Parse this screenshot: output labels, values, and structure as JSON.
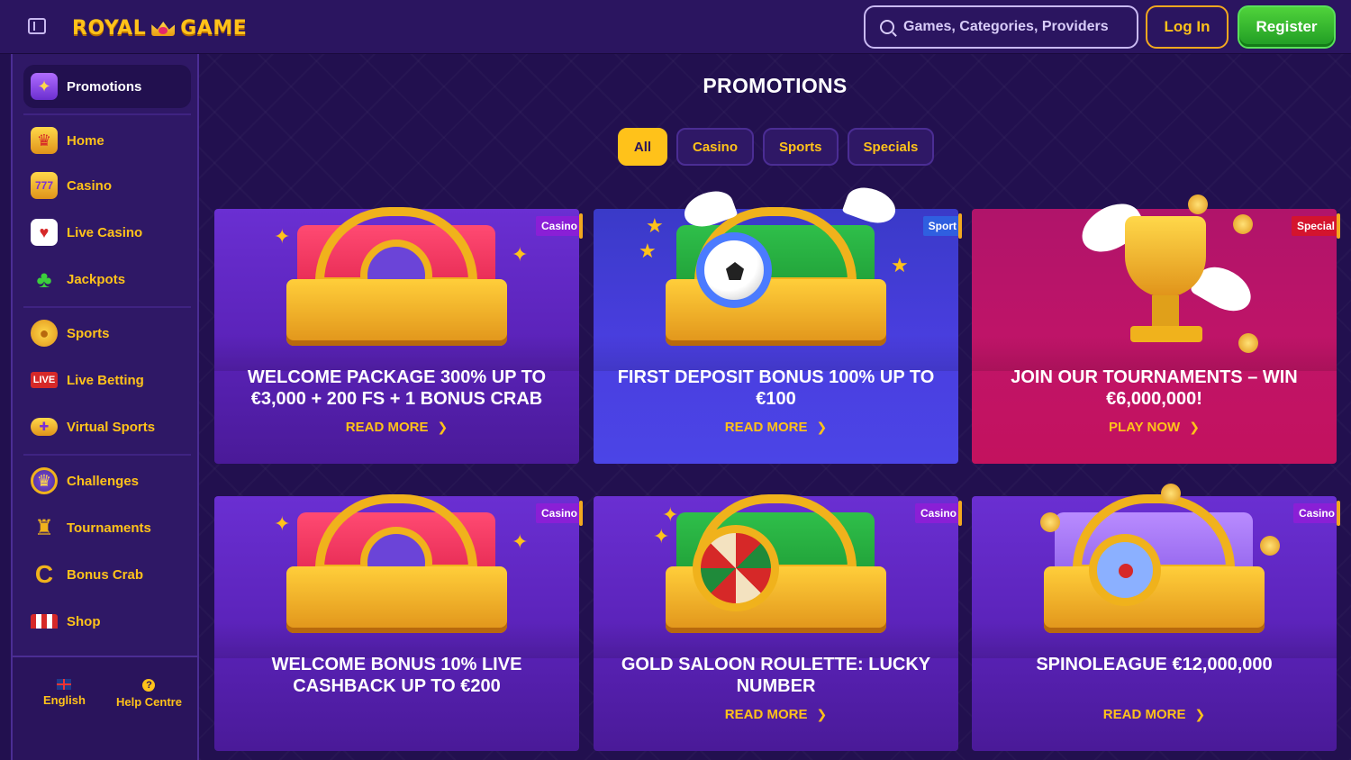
{
  "header": {
    "brand_part1": "ROYAL",
    "brand_part2": "GAME",
    "search_placeholder": "Games, Categories, Providers",
    "login_label": "Log In",
    "register_label": "Register"
  },
  "sidebar": {
    "items": [
      {
        "label": "Promotions",
        "icon": "gift-icon"
      },
      {
        "label": "Home",
        "icon": "crown-home-icon"
      },
      {
        "label": "Casino",
        "icon": "slot-machine-icon"
      },
      {
        "label": "Live Casino",
        "icon": "cards-icon"
      },
      {
        "label": "Jackpots",
        "icon": "clover-icon"
      },
      {
        "label": "Sports",
        "icon": "ball-icon"
      },
      {
        "label": "Live Betting",
        "icon": "live-badge-icon",
        "badge": "LIVE"
      },
      {
        "label": "Virtual Sports",
        "icon": "gamepad-icon"
      },
      {
        "label": "Challenges",
        "icon": "medal-icon"
      },
      {
        "label": "Tournaments",
        "icon": "trophy-icon"
      },
      {
        "label": "Bonus Crab",
        "icon": "crab-claw-icon"
      },
      {
        "label": "Shop",
        "icon": "shop-icon"
      }
    ],
    "footer": {
      "language_label": "English",
      "help_label": "Help Centre",
      "help_glyph": "?"
    }
  },
  "main": {
    "title": "PROMOTIONS",
    "filters": [
      "All",
      "Casino",
      "Sports",
      "Specials"
    ],
    "active_filter": "All",
    "cards": [
      {
        "tag": "Casino",
        "title": "WELCOME PACKAGE 300% UP TO €3,000 + 200 FS + 1 BONUS CRAB",
        "link": "READ MORE"
      },
      {
        "tag": "Sport",
        "title": "FIRST DEPOSIT BONUS 100% UP TO €100",
        "link": "READ MORE"
      },
      {
        "tag": "Special",
        "title": "JOIN OUR TOURNAMENTS – WIN €6,000,000!",
        "link": "PLAY NOW"
      },
      {
        "tag": "Casino",
        "title": "WELCOME BONUS 10% LIVE CASHBACK UP TO €200",
        "link": ""
      },
      {
        "tag": "Casino",
        "title": "GOLD SALOON ROULETTE: LUCKY NUMBER",
        "link": "READ MORE"
      },
      {
        "tag": "Casino",
        "title": "SPINOLEAGUE €12,000,000",
        "link": "READ MORE"
      }
    ]
  },
  "colors": {
    "background": "#22104f",
    "header": "#2b1560",
    "sidebar": "#2f1866",
    "accent_gold": "#ffc21a",
    "register_green": "#2fb52c",
    "card_purple": "#5a22b8",
    "card_blue": "#4a3ee0",
    "card_pink": "#c01468"
  }
}
